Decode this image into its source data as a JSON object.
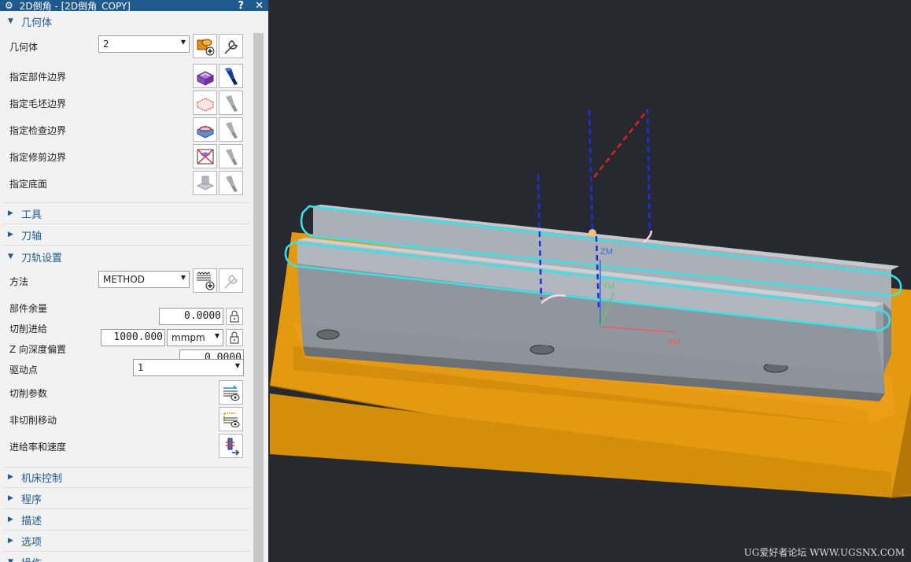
{
  "window": {
    "title": "2D倒角 - [2D倒角_COPY]",
    "help_glyph": "?",
    "close_glyph": "✕",
    "gear_glyph": "⚙"
  },
  "groups": {
    "geometry": {
      "label": "几何体",
      "expanded": true
    },
    "tool": {
      "label": "工具",
      "expanded": false
    },
    "axis": {
      "label": "刀轴",
      "expanded": false
    },
    "path": {
      "label": "刀轨设置",
      "expanded": true
    },
    "machine": {
      "label": "机床控制",
      "expanded": false
    },
    "program": {
      "label": "程序",
      "expanded": false
    },
    "description": {
      "label": "描述",
      "expanded": false
    },
    "options": {
      "label": "选项",
      "expanded": false
    },
    "actions": {
      "label": "操作",
      "expanded": true
    }
  },
  "geometry": {
    "geometry_label": "几何体",
    "geometry_value": "2",
    "part_boundary": "指定部件边界",
    "blank_boundary": "指定毛坯边界",
    "check_boundary": "指定检查边界",
    "trim_boundary": "指定修剪边界",
    "floor": "指定底面"
  },
  "path": {
    "method_label": "方法",
    "method_value": "METHOD",
    "stock_label": "部件余量",
    "stock_value": "0.0000",
    "feed_label": "切削进给",
    "feed_value": "1000.000",
    "feed_unit": "mmpm",
    "zdepth_label": "Z 向深度偏置",
    "zdepth_value": "0.0000",
    "drive_label": "驱动点",
    "drive_value": "1",
    "cut_params": "切削参数",
    "non_cut_moves": "非切削移动",
    "feeds_speeds": "进给率和速度"
  },
  "viewport": {
    "axes": {
      "zm": "ZM",
      "ym": "YM",
      "xm": "XM"
    },
    "watermark": "UG爱好者论坛 WWW.UGSNX.COM"
  },
  "colors": {
    "title_bar": "#1f5a8f",
    "group_text": "#1f5a8f",
    "viewport_bg": "#262a30",
    "fixture_orange": "#e39a10",
    "part_gray": "#a7aeb6",
    "toolpath_cyan": "#37e3e8"
  }
}
